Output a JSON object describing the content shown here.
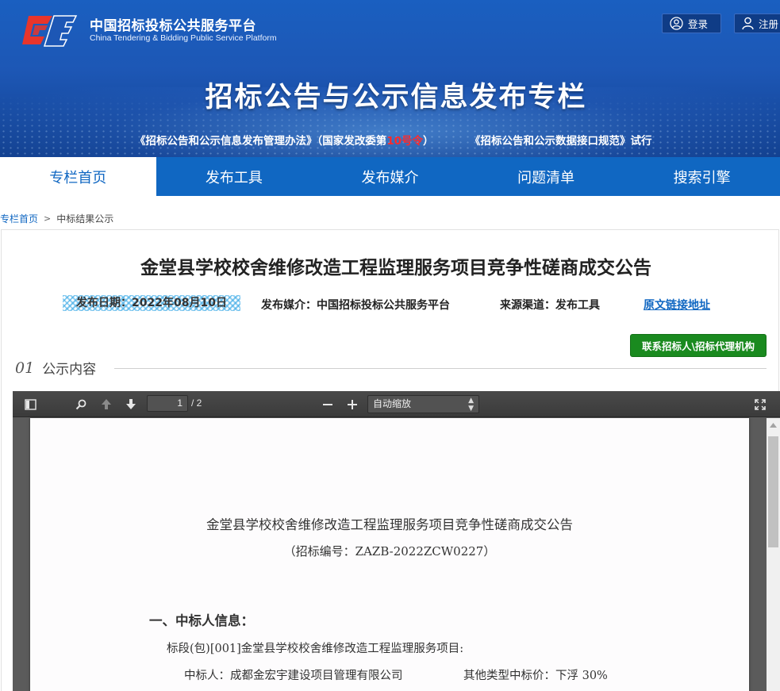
{
  "header": {
    "site_name_cn": "中国招标投标公共服务平台",
    "site_name_en": "China Tendering & Bidding Public Service Platform",
    "login_label": "登录",
    "register_label": "注册",
    "banner_title": "招标公告与公示信息发布专栏",
    "regulation_1_prefix": "《招标公告和公示信息发布管理办法》（国家发改委第",
    "regulation_1_highlight": "10号令",
    "regulation_1_suffix": "）",
    "regulation_2": "《招标公告和公示数据接口规范》试行",
    "logo_colors": [
      "#e8352b",
      "#1d57b5"
    ]
  },
  "nav": {
    "items": [
      {
        "label": "专栏首页",
        "active": true
      },
      {
        "label": "发布工具",
        "active": false
      },
      {
        "label": "发布媒介",
        "active": false
      },
      {
        "label": "问题清单",
        "active": false
      },
      {
        "label": "搜索引擎",
        "active": false
      }
    ]
  },
  "breadcrumb": {
    "home": "专栏首页",
    "separator": ">",
    "current": "中标结果公示"
  },
  "notice": {
    "title": "金堂县学校校舍维修改造工程监理服务项目竞争性磋商成交公告",
    "publish_date": "发布日期：2022年08月10日",
    "publish_media": "发布媒介：中国招标投标公共服务平台",
    "source_channel": "来源渠道：发布工具",
    "original_link": "原文链接地址",
    "contact_button": "联系招标人\\招标代理机构",
    "section_number": "01",
    "section_label": "公示内容"
  },
  "pdf_viewer": {
    "current_page": "1",
    "page_count": "/ 2",
    "zoom": "自动缩放",
    "document": {
      "title": "金堂县学校校舍维修改造工程监理服务项目竞争性磋商成交公告",
      "code": "（招标编号：ZAZB-2022ZCW0227）",
      "heading_1": "一、中标人信息：",
      "lot_line": "标段(包)[001]金堂县学校校舍维修改造工程监理服务项目:",
      "winner": "中标人：成都金宏宇建设项目管理有限公司",
      "price": "其他类型中标价：下浮 30%"
    }
  },
  "colors": {
    "nav_blue": "#1067c2",
    "contact_green": "#1a8a1f",
    "highlight_red": "#ff2a2a"
  }
}
